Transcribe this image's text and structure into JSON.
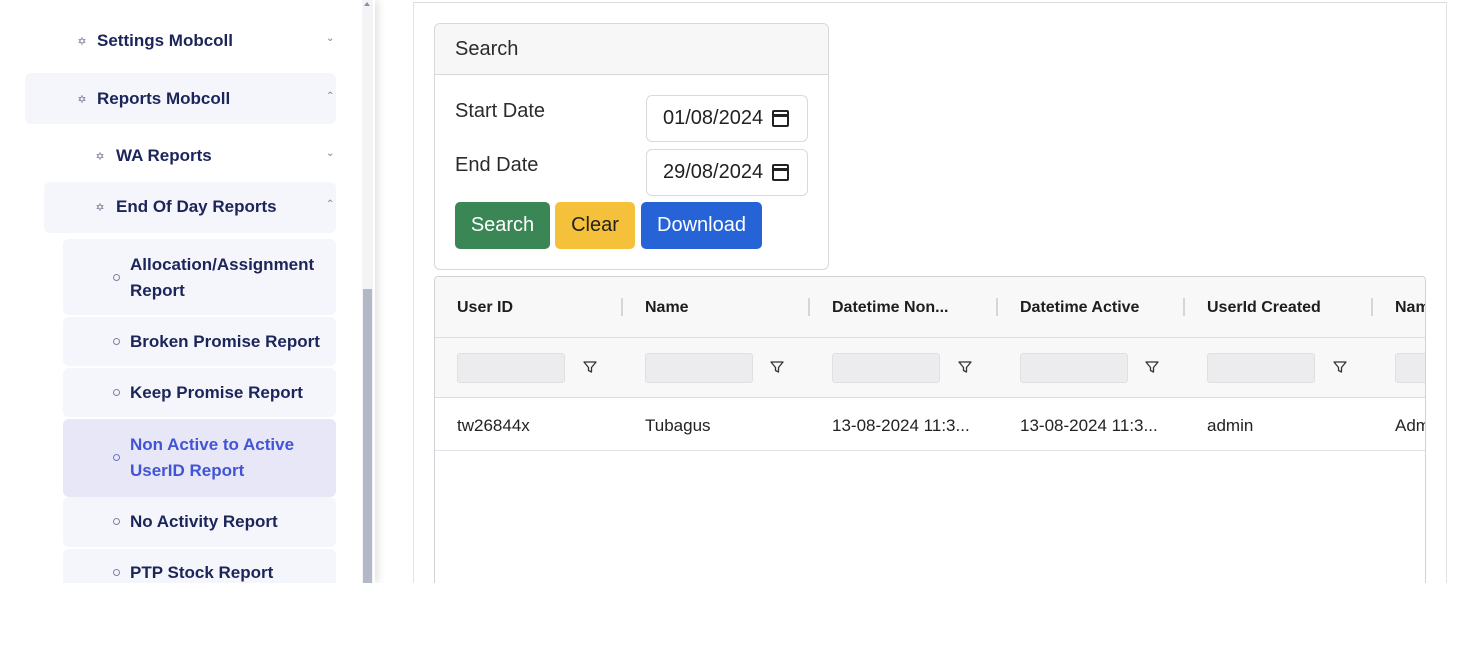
{
  "sidebar": {
    "items": [
      {
        "label": "Settings Mobcoll",
        "icon": "hexagon-icon",
        "expanded": false
      },
      {
        "label": "Reports Mobcoll",
        "icon": "hexagon-icon",
        "expanded": true
      },
      {
        "label": "WA Reports",
        "icon": "hexagon-icon",
        "expanded": false
      },
      {
        "label": "End Of Day Reports",
        "icon": "hexagon-icon",
        "expanded": true
      }
    ],
    "subitems": [
      {
        "label_line1": "Allocation/Assignment",
        "label_line2": "Report"
      },
      {
        "label_line1": "Broken Promise Report"
      },
      {
        "label_line1": "Keep Promise Report"
      },
      {
        "label_line1": "Non Active to Active",
        "label_line2": "UserID Report",
        "active": true
      },
      {
        "label_line1": "No Activity Report"
      },
      {
        "label_line1": "PTP Stock Report"
      }
    ]
  },
  "search": {
    "title": "Search",
    "start_label": "Start Date",
    "start_value": "01/08/2024",
    "end_label": "End Date",
    "end_value": "29/08/2024",
    "search_btn": "Search",
    "clear_btn": "Clear",
    "download_btn": "Download"
  },
  "grid": {
    "columns": [
      "User ID",
      "Name",
      "Datetime Non...",
      "Datetime Active",
      "UserId Created",
      "Nam"
    ],
    "rows": [
      [
        "tw26844x",
        "Tubagus",
        "13-08-2024 11:3...",
        "13-08-2024 11:3...",
        "admin",
        "Adm"
      ]
    ]
  },
  "colors": {
    "sidebar_text": "#1b2559",
    "active_text": "#4254d6",
    "active_bg": "#e7e7f8",
    "search_btn": "#3a8655",
    "clear_btn": "#f5c03a",
    "download_btn": "#2563d6"
  }
}
